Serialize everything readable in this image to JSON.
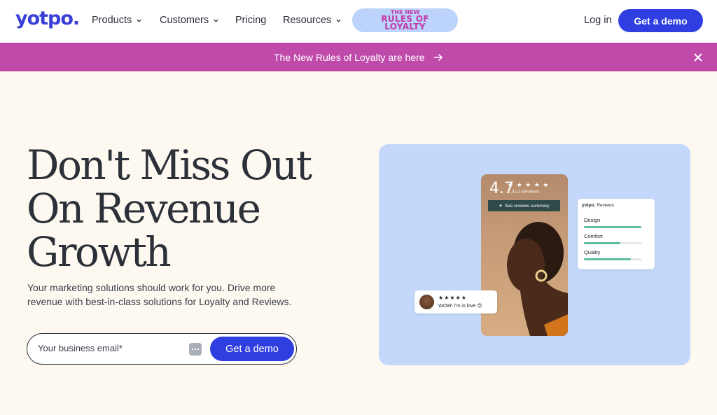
{
  "nav": {
    "logo": "yotpo.",
    "items": [
      {
        "label": "Products",
        "dropdown": true
      },
      {
        "label": "Customers",
        "dropdown": true
      },
      {
        "label": "Pricing",
        "dropdown": false
      },
      {
        "label": "Resources",
        "dropdown": true
      }
    ],
    "promo_line1": "THE NEW",
    "promo_line2": "RULES OF",
    "promo_line3": "LOYALTY",
    "login": "Log in",
    "demo": "Get a demo"
  },
  "banner": {
    "text": "The New Rules of Loyalty are here",
    "arrow_icon": "arrow-right-icon",
    "close_icon": "close-icon"
  },
  "hero": {
    "title_line1": "Don't Miss Out",
    "title_line2": "On Revenue",
    "title_line3": "Growth",
    "subtitle": "Your marketing solutions should work for you. Drive more revenue with best-in-class solutions for Loyalty and Reviews.",
    "email_placeholder": "Your business email*",
    "cta": "Get a demo"
  },
  "visual": {
    "rating": "4.7",
    "stars": "★ ★ ★ ★ ★",
    "review_count": "1,412 Reviews",
    "summary_button": "See reviews summary",
    "chip_stars": "★★★★★",
    "chip_text": "WOW! i'm in love 😍",
    "stats_brand": "yotpo.",
    "stats_title": "Reviews",
    "stats": [
      {
        "label": "Design",
        "value": 1.0
      },
      {
        "label": "Comfort",
        "value": 0.64
      },
      {
        "label": "Quality",
        "value": 0.82
      }
    ]
  },
  "colors": {
    "brand_blue": "#2f3ee0",
    "banner_pink": "#c04aaa",
    "bar_green": "#5dbf9a"
  }
}
